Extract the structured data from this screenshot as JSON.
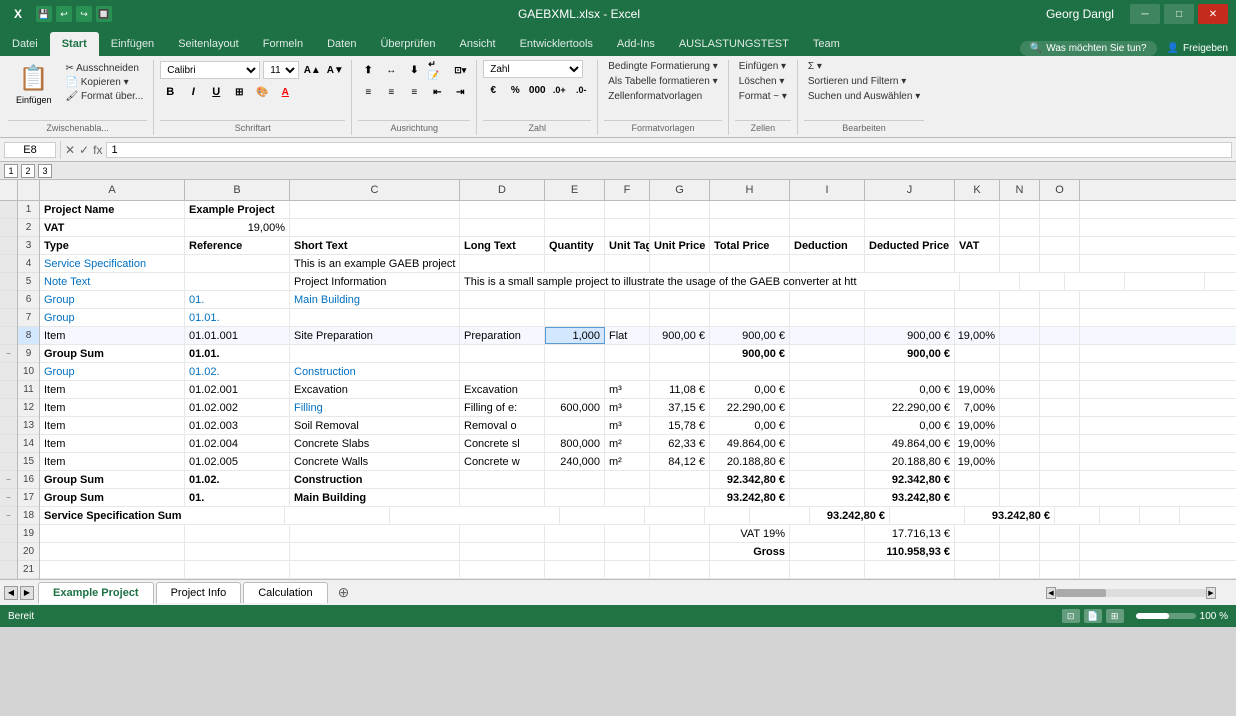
{
  "titleBar": {
    "filename": "GAEBXML.xlsx - Excel",
    "user": "Georg Dangl"
  },
  "ribbon": {
    "tabs": [
      "Datei",
      "Start",
      "Einfügen",
      "Seitenlayout",
      "Formeln",
      "Daten",
      "Überprüfen",
      "Ansicht",
      "Entwicklertools",
      "Add-Ins",
      "AUSLASTUNGSTEST",
      "Team"
    ],
    "activeTab": "Start",
    "searchPlaceholder": "Was möchten Sie tun?",
    "shareLabel": "Freigeben",
    "groups": {
      "clipboard": "Zwischenabla...",
      "font": "Schriftart",
      "alignment": "Ausrichtung",
      "number": "Zahl",
      "styles": "Formatvorlagen",
      "cells": "Zellen",
      "editing": "Bearbeiten"
    },
    "fontName": "Calibri",
    "fontSize": "11",
    "numberFormat": "Zahl",
    "buttons": {
      "paste": "Einfügen",
      "insert": "Einfügen",
      "delete": "Löschen",
      "format": "Format ~",
      "sort": "Sortieren und\nFiltern ~",
      "find": "Suchen und\nAuswählen ~",
      "conditional": "Bedingte\nFormatierung ~",
      "asTable": "Als Tabelle\nformatieren ~",
      "cellStyles": "Zellenformatvorlagen"
    }
  },
  "formulaBar": {
    "cellRef": "E8",
    "formula": "1"
  },
  "levels": [
    "1",
    "2",
    "3"
  ],
  "columns": {
    "headers": [
      "A",
      "B",
      "C",
      "D",
      "E",
      "F",
      "G",
      "H",
      "I",
      "J",
      "K",
      "N",
      "O"
    ]
  },
  "rows": [
    {
      "num": 1,
      "cells": {
        "A": "Project Name",
        "B": "Example Project",
        "C": "",
        "D": "",
        "E": "",
        "F": "",
        "G": "",
        "H": "",
        "I": "",
        "J": "",
        "K": ""
      }
    },
    {
      "num": 2,
      "cells": {
        "A": "VAT",
        "B": "19,00%",
        "C": "",
        "D": "",
        "E": "",
        "F": "",
        "G": "",
        "H": "",
        "I": "",
        "J": "",
        "K": ""
      }
    },
    {
      "num": 3,
      "cells": {
        "A": "Type",
        "B": "Reference",
        "C": "Short Text",
        "D": "Long Text",
        "E": "Quantity",
        "F": "Unit Tag",
        "G": "Unit Price",
        "H": "Total Price",
        "I": "Deduction",
        "J": "Deducted Price",
        "K": "VAT"
      }
    },
    {
      "num": 4,
      "cells": {
        "A": "Service Specification",
        "B": "",
        "C": "This is an example GAEB project",
        "D": "",
        "E": "",
        "F": "",
        "G": "",
        "H": "",
        "I": "",
        "J": "",
        "K": ""
      }
    },
    {
      "num": 5,
      "cells": {
        "A": "Note Text",
        "B": "",
        "C": "Project Information",
        "D": "This is a small sample project to illustrate the usage of the GAEB converter at htt",
        "E": "",
        "F": "",
        "G": "",
        "H": "",
        "I": "",
        "J": "",
        "K": ""
      }
    },
    {
      "num": 6,
      "cells": {
        "A": "Group",
        "B": "01.",
        "C": "Main Building",
        "D": "",
        "E": "",
        "F": "",
        "G": "",
        "H": "",
        "I": "",
        "J": "",
        "K": ""
      }
    },
    {
      "num": 7,
      "cells": {
        "A": "Group",
        "B": "01.01.",
        "C": "",
        "D": "",
        "E": "",
        "F": "",
        "G": "",
        "H": "",
        "I": "",
        "J": "",
        "K": ""
      }
    },
    {
      "num": 8,
      "cells": {
        "A": "Item",
        "B": "01.01.001",
        "C": "Site Preparation",
        "D": "Preparation",
        "E": "1,000",
        "F": "Flat",
        "G": "900,00 €",
        "H": "900,00 €",
        "I": "",
        "J": "900,00 €",
        "K": "19,00%"
      }
    },
    {
      "num": 9,
      "cells": {
        "A": "Group Sum",
        "B": "01.01.",
        "C": "",
        "D": "",
        "E": "",
        "F": "",
        "G": "",
        "H": "900,00 €",
        "I": "",
        "J": "900,00 €",
        "K": ""
      }
    },
    {
      "num": 10,
      "cells": {
        "A": "Group",
        "B": "01.02.",
        "C": "Construction",
        "D": "",
        "E": "",
        "F": "",
        "G": "",
        "H": "",
        "I": "",
        "J": "",
        "K": ""
      }
    },
    {
      "num": 11,
      "cells": {
        "A": "Item",
        "B": "01.02.001",
        "C": "Excavation",
        "D": "Excavation",
        "E": "",
        "F": "m³",
        "G": "11,08 €",
        "H": "0,00 €",
        "I": "",
        "J": "0,00 €",
        "K": "19,00%"
      }
    },
    {
      "num": 12,
      "cells": {
        "A": "Item",
        "B": "01.02.002",
        "C": "Filling",
        "D": "Filling of e:",
        "E": "600,000",
        "F": "m³",
        "G": "37,15 €",
        "H": "22.290,00 €",
        "I": "",
        "J": "22.290,00 €",
        "K": "7,00%"
      }
    },
    {
      "num": 13,
      "cells": {
        "A": "Item",
        "B": "01.02.003",
        "C": "Soil Removal",
        "D": "Removal o",
        "E": "",
        "F": "m³",
        "G": "15,78 €",
        "H": "0,00 €",
        "I": "",
        "J": "0,00 €",
        "K": "19,00%"
      }
    },
    {
      "num": 14,
      "cells": {
        "A": "Item",
        "B": "01.02.004",
        "C": "Concrete Slabs",
        "D": "Concrete sl",
        "E": "800,000",
        "F": "m²",
        "G": "62,33 €",
        "H": "49.864,00 €",
        "I": "",
        "J": "49.864,00 €",
        "K": "19,00%"
      }
    },
    {
      "num": 15,
      "cells": {
        "A": "Item",
        "B": "01.02.005",
        "C": "Concrete Walls",
        "D": "Concrete w",
        "E": "240,000",
        "F": "m²",
        "G": "84,12 €",
        "H": "20.188,80 €",
        "I": "",
        "J": "20.188,80 €",
        "K": "19,00%"
      }
    },
    {
      "num": 16,
      "cells": {
        "A": "Group Sum",
        "B": "01.02.",
        "C": "Construction",
        "D": "",
        "E": "",
        "F": "",
        "G": "",
        "H": "92.342,80 €",
        "I": "",
        "J": "92.342,80 €",
        "K": ""
      }
    },
    {
      "num": 17,
      "cells": {
        "A": "Group Sum",
        "B": "01.",
        "C": "Main Building",
        "D": "",
        "E": "",
        "F": "",
        "G": "",
        "H": "93.242,80 €",
        "I": "",
        "J": "93.242,80 €",
        "K": ""
      }
    },
    {
      "num": 18,
      "cells": {
        "A": "Service Specification Sum",
        "B": "",
        "C": "",
        "D": "",
        "E": "",
        "F": "",
        "G": "",
        "H": "93.242,80 €",
        "I": "",
        "J": "93.242,80 €",
        "K": ""
      }
    },
    {
      "num": 19,
      "cells": {
        "A": "",
        "B": "",
        "C": "",
        "D": "",
        "E": "",
        "F": "",
        "G": "",
        "H": "VAT 19%",
        "I": "",
        "J": "17.716,13 €",
        "K": ""
      }
    },
    {
      "num": 20,
      "cells": {
        "A": "",
        "B": "",
        "C": "",
        "D": "",
        "E": "",
        "F": "",
        "G": "",
        "H": "Gross",
        "I": "",
        "J": "110.958,93 €",
        "K": ""
      }
    },
    {
      "num": 21,
      "cells": {
        "A": "",
        "B": "",
        "C": "",
        "D": "",
        "E": "",
        "F": "",
        "G": "",
        "H": "",
        "I": "",
        "J": "",
        "K": ""
      }
    }
  ],
  "sheetTabs": [
    "Example Project",
    "Project Info",
    "Calculation"
  ],
  "activeSheet": "Example Project",
  "statusBar": {
    "status": "Bereit",
    "zoom": "100 %"
  }
}
